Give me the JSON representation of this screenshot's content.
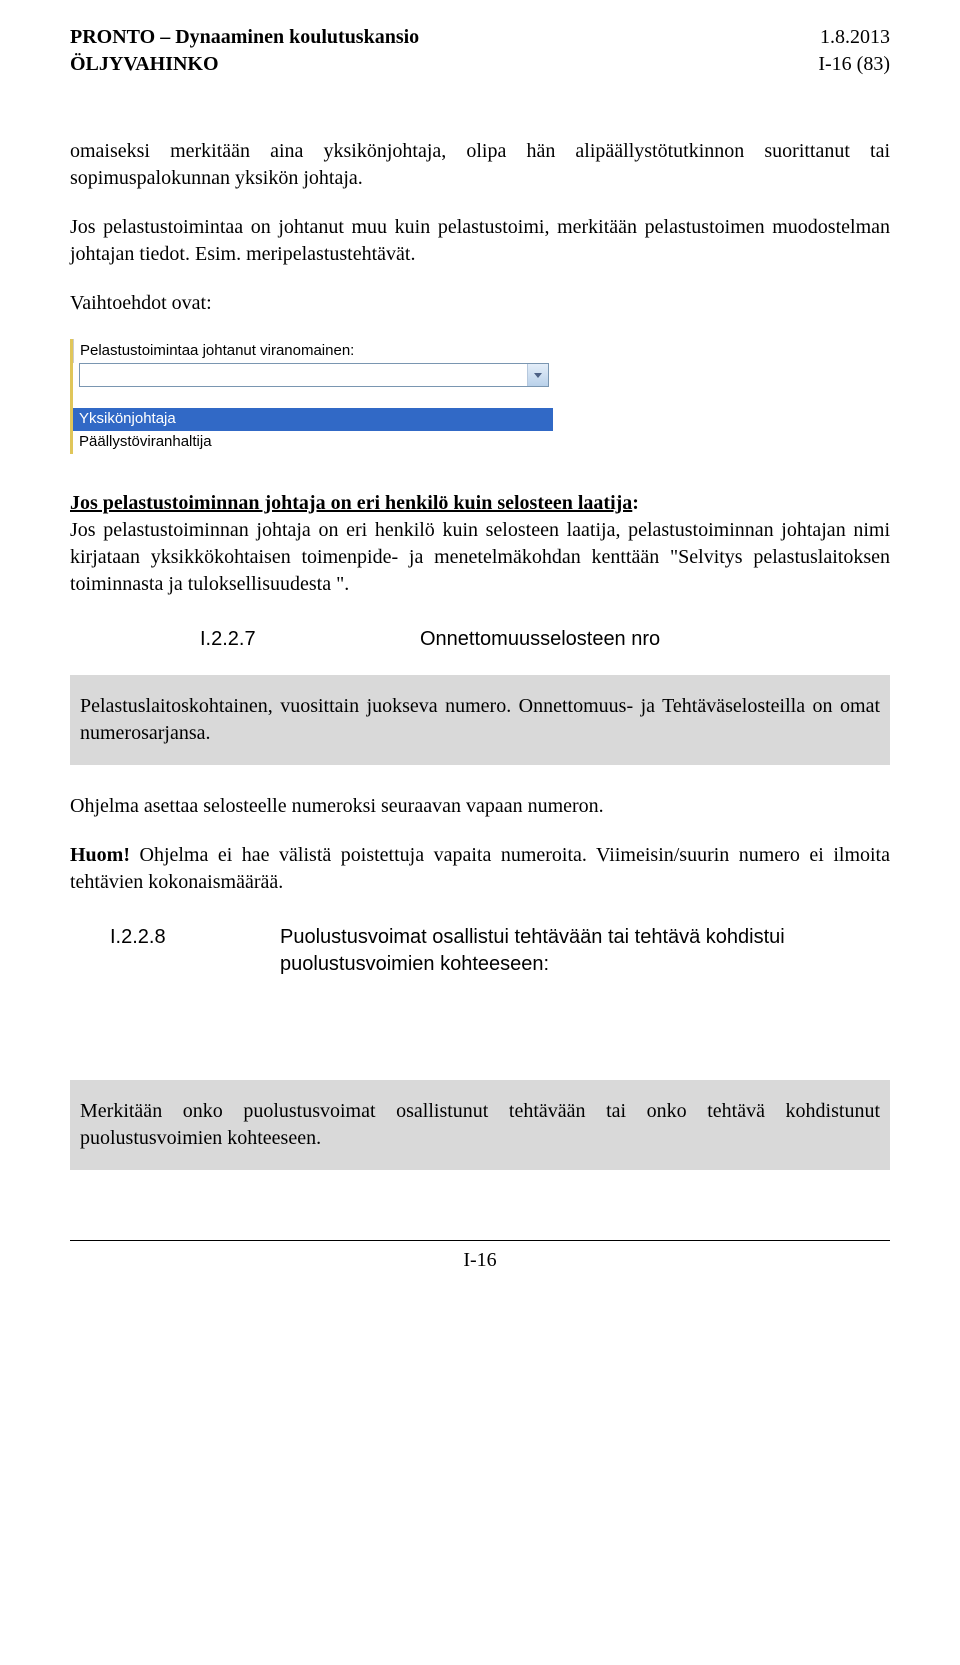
{
  "header": {
    "left_line1": "PRONTO – Dynaaminen koulutuskansio",
    "left_line2": "ÖLJYVAHINKO",
    "right_line1": "1.8.2013",
    "right_line2": "I-16 (83)"
  },
  "para": {
    "p1a": "omaiseksi merkitään aina yksikönjohtaja, olipa hän alipäällystötutkinnon suorittanut tai sopimuspalokunnan yksikön johtaja.",
    "p2": "Jos pelastustoimintaa on johtanut muu kuin pelastustoimi, merkitään pelastustoimen muodostelman johtajan tiedot. Esim. meripelastustehtävät.",
    "p3": "Vaihtoehdot ovat:"
  },
  "dropdown": {
    "label": "Pelastustoimintaa johtanut viranomainen:",
    "options": {
      "blank": "",
      "opt1": "Yksikönjohtaja",
      "opt2": "Päällystöviranhaltija"
    }
  },
  "para2": {
    "heading": "Jos pelastustoiminnan johtaja on eri henkilö kuin selosteen laatija",
    "colon": ":",
    "body": "Jos pelastustoiminnan johtaja on eri henkilö kuin selosteen laatija, pelastustoiminnan johtajan nimi kirjataan yksikkökohtaisen toimenpide- ja menetelmäkohdan kenttään \"Selvitys pelastuslaitoksen toiminnasta ja tuloksellisuudesta \"."
  },
  "section227": {
    "num": "I.2.2.7",
    "title": "Onnettomuusselosteen nro"
  },
  "graybox1": "Pelastuslaitoskohtainen, vuosittain juokseva numero. Onnettomuus- ja Tehtäväselosteilla on omat numerosarjansa.",
  "para3": {
    "p1": "Ohjelma asettaa selosteelle numeroksi seuraavan vapaan numeron.",
    "huom_label": "Huom!",
    "huom_rest": " Ohjelma ei hae välistä poistettuja vapaita numeroita. Viimeisin/suurin numero ei ilmoita tehtävien kokonaismäärää."
  },
  "section228": {
    "num": "I.2.2.8",
    "title": "Puolustusvoimat osallistui tehtävään tai tehtävä kohdistui puolustusvoimien kohteeseen:"
  },
  "graybox2": "Merkitään onko puolustusvoimat osallistunut tehtävään tai onko tehtävä kohdistunut puolustusvoimien kohteeseen.",
  "footer": "I-16"
}
